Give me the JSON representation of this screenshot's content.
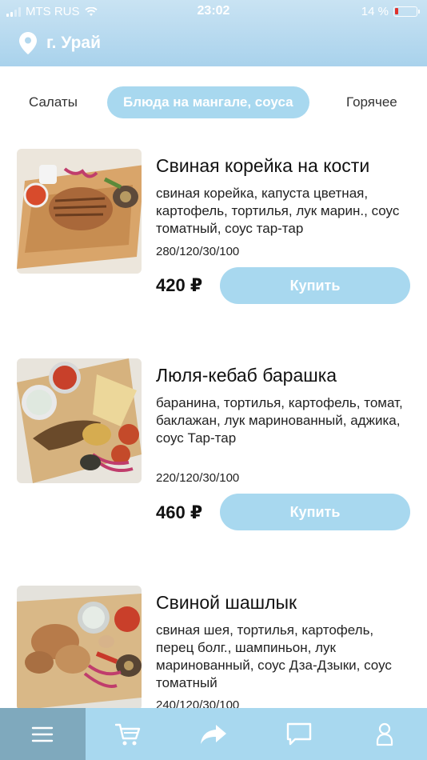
{
  "status_bar": {
    "carrier": "MTS RUS",
    "time": "23:02",
    "battery_percent": "14 %",
    "battery_level": 0.14
  },
  "header": {
    "city": "г. Урай"
  },
  "categories": {
    "items": [
      "Салаты",
      "Блюда на мангале, соуса",
      "Горячее"
    ],
    "active_index": 1
  },
  "products": [
    {
      "name": "Свиная корейка на кости",
      "description": "свиная корейка, капуста цветная, картофель, тортилья, лук марин., соус томатный, соус тар-тар",
      "weight": "280/120/30/100",
      "price": "420 ₽",
      "buy_label": "Купить"
    },
    {
      "name": "Люля-кебаб барашка",
      "description": "баранина, тортилья, картофель, томат, баклажан, лук маринованный, аджика, соус Тар-тар",
      "weight": "220/120/30/100",
      "price": "460 ₽",
      "buy_label": "Купить"
    },
    {
      "name": "Свиной шашлык",
      "description": "свиная шея, тортилья, картофель, перец болг., шампиньон, лук маринованный, соус Дза-Дзыки, соус томатный",
      "weight": "240/120/30/100",
      "price": "",
      "buy_label": ""
    }
  ],
  "bottom_nav": {
    "items": [
      "menu-icon",
      "cart-icon",
      "share-icon",
      "chat-icon",
      "profile-icon"
    ],
    "active_index": 0
  },
  "colors": {
    "accent": "#a8d8ef",
    "nav_active": "#7fa9bd",
    "battery_low": "#e0322d"
  }
}
